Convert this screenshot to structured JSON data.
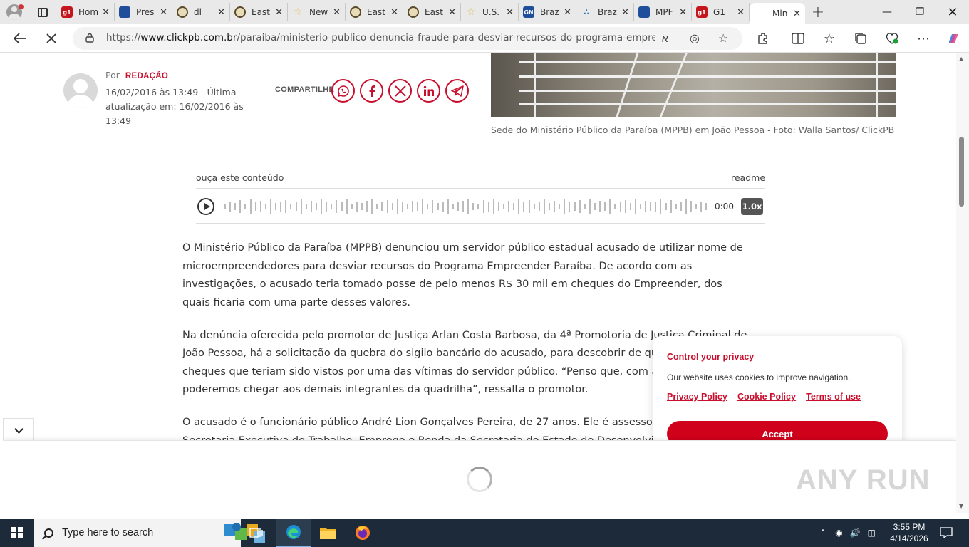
{
  "browser": {
    "tabs": [
      {
        "title": "Hom",
        "favicon": "g1-icon",
        "color": "#c4161c"
      },
      {
        "title": "Pres",
        "favicon": "news-icon",
        "color": "#1f4e9b"
      },
      {
        "title": "dl",
        "favicon": "seal-icon",
        "color": "#5a4a2a"
      },
      {
        "title": "East",
        "favicon": "seal-icon",
        "color": "#5a4a2a"
      },
      {
        "title": "New",
        "favicon": "star-icon",
        "color": "#e0c060"
      },
      {
        "title": "East",
        "favicon": "seal-icon",
        "color": "#5a4a2a"
      },
      {
        "title": "East",
        "favicon": "seal-icon",
        "color": "#5a4a2a"
      },
      {
        "title": "U.S.",
        "favicon": "star-icon",
        "color": "#e0c060"
      },
      {
        "title": "Braz",
        "favicon": "gn-icon",
        "color": "#1f4e9b"
      },
      {
        "title": "Braz",
        "favicon": "dots-icon",
        "color": "#2a7ab8"
      },
      {
        "title": "MPF",
        "favicon": "news-icon",
        "color": "#1f4e9b"
      },
      {
        "title": "G1",
        "favicon": "g1-icon",
        "color": "#c4161c"
      },
      {
        "title": "Min",
        "favicon": "none",
        "color": "#ffffff",
        "active": true
      }
    ],
    "url_prefix": "https://",
    "url_host": "www.clickpb.com.br",
    "url_path": "/paraiba/ministerio-publico-denuncia-fraude-para-desviar-recursos-do-programa-empreende..."
  },
  "article": {
    "by_label": "Por",
    "author": "REDAÇÃO",
    "date": "16/02/2016 às 13:49 - Última atualização em: 16/02/2016 às 13:49",
    "share_label": "COMPARTILHE",
    "share_icons": [
      "whatsapp-icon",
      "facebook-icon",
      "x-icon",
      "linkedin-icon",
      "telegram-icon"
    ],
    "photo_caption": "Sede do Ministério Público da Paraíba (MPPB) em João Pessoa - Foto: Walla Santos/ ClickPB",
    "audio": {
      "label": "ouça este conteúdo",
      "provider": "readme",
      "time": "0:00",
      "speed": "1.0x"
    },
    "paragraphs": [
      "O Ministério Público da Paraíba (MPPB) denunciou um servidor público estadual acusado de utilizar nome de microempreendedores para desviar recursos do Programa Empreender Paraíba. De acordo com as investigações, o acusado teria tomado posse de pelo menos R$ 30 mil em cheques do Empreender, dos quais ficaria com uma parte desses valores.",
      "Na denúncia oferecida pelo promotor de Justiça Arlan Costa Barbosa, da 4ª Promotoria de Justiça Criminal de João Pessoa, há a solicitação da quebra do sigilo bancário do acusado, para descobrir de quem são os cheques que teriam sido vistos por uma das vítimas do servidor público. “Penso que, com a medida, poderemos chegar aos demais integrantes da quadrilha”, ressalta o promotor.",
      "O acusado é o funcionário público André Lion Gonçalves Pereira, de 27 anos. Ele é assessor técnico da Secretaria Executiva do Trabalho, Emprego e Renda da Secretaria do Estado de Desenvolvimento Humano"
    ]
  },
  "cookie": {
    "title": "Control your privacy",
    "message": "Our website uses cookies to improve navigation.",
    "links": [
      "Privacy Policy",
      "Cookie Policy",
      "Terms of use"
    ],
    "sep": "-",
    "accept": "Accept"
  },
  "watermark": "ANY RUN",
  "taskbar": {
    "search_placeholder": "Type here to search",
    "time": "3:55 PM",
    "date": "4/14/2026"
  }
}
